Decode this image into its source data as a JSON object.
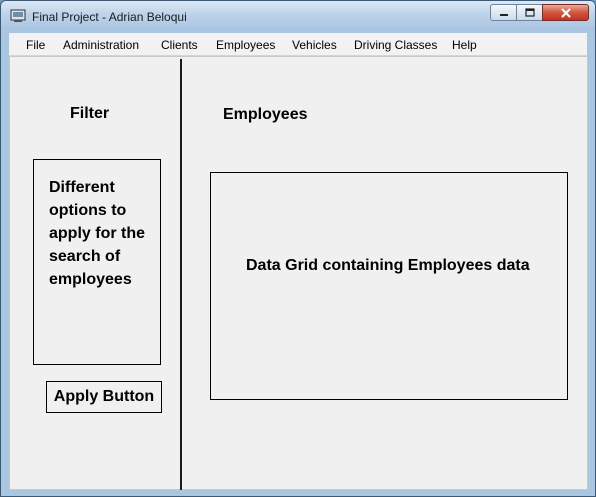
{
  "window": {
    "title": "Final Project - Adrian Beloqui",
    "icon": "app-icon",
    "controls": [
      "minimize-icon",
      "maximize-icon",
      "close-icon"
    ]
  },
  "menu": {
    "items": [
      "File",
      "Administration",
      "Clients",
      "Employees",
      "Vehicles",
      "Driving Classes",
      "Help"
    ]
  },
  "left_panel": {
    "header": "Filter",
    "filter_box_text": "Different options to apply for the search of employees",
    "apply_button": "Apply Button"
  },
  "right_panel": {
    "header": "Employees",
    "grid_text": "Data Grid containing Employees data"
  },
  "colors": {
    "titlebar": "#bdd3ea",
    "client_bg": "#f0f0f0",
    "close_button": "#c2351f"
  }
}
